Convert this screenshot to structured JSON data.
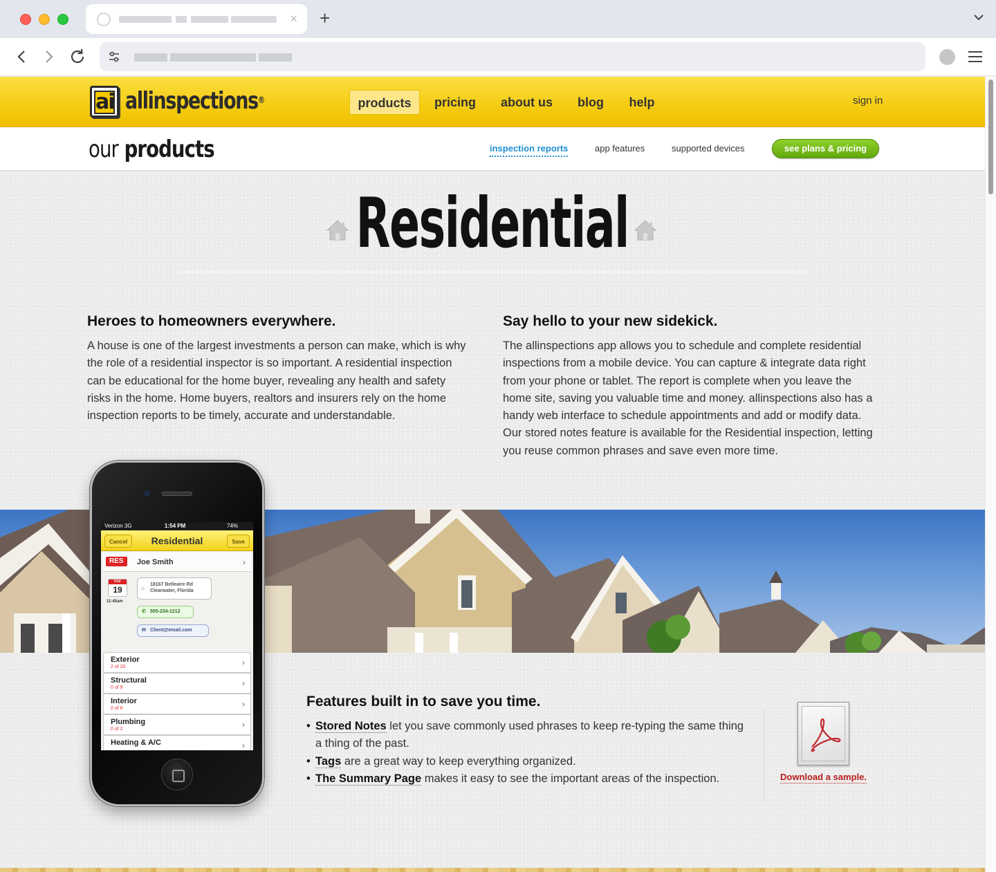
{
  "browser": {
    "tab_close_glyph": "×",
    "new_tab_glyph": "+"
  },
  "header": {
    "logo_mark": "ai",
    "logo_text": "allinspections",
    "logo_reg": "®",
    "nav": [
      {
        "label": "products",
        "active": true
      },
      {
        "label": "pricing",
        "active": false
      },
      {
        "label": "about us",
        "active": false
      },
      {
        "label": "blog",
        "active": false
      },
      {
        "label": "help",
        "active": false
      }
    ],
    "signin": "sign in"
  },
  "subnav": {
    "title_prefix": "our",
    "title_main": "products",
    "tabs": [
      {
        "label": "inspection reports",
        "active": true
      },
      {
        "label": "app features",
        "active": false
      },
      {
        "label": "supported devices",
        "active": false
      }
    ],
    "cta": "see plans & pricing"
  },
  "hero": {
    "title": "Residential"
  },
  "left": {
    "heading": "Heroes to homeowners everywhere.",
    "body": "A house is one of the largest investments a person can make, which is why the role of a residential inspector is so important. A residential inspection can be educational for the home buyer, revealing any health and safety risks in the home. Home buyers, realtors and insurers rely on the home inspection reports to be timely, accurate and understandable."
  },
  "right": {
    "heading": "Say hello to your new sidekick.",
    "body": "The allinspections app allows you to schedule and complete residential inspections from a mobile device. You can capture & integrate data right from your phone or tablet. The report is complete when you leave the home site, saving you valuable time and money. allinspections also has a handy web interface to schedule appointments and add or modify data. Our stored notes feature is available for the Residential inspection, letting you reuse common phrases and save even more time."
  },
  "phone": {
    "carrier": "Verizon 3G",
    "time": "1:54 PM",
    "battery": "74%",
    "cancel": "Cancel",
    "title": "Residential",
    "save": "Save",
    "badge": "RES",
    "client": "Joe Smith",
    "cal_month": "Mar",
    "cal_day": "19",
    "appt_time": "11:45am",
    "address_line1": "18167 Belleaire Rd",
    "address_line2": "Clearwater, Florida",
    "phone_number": "555-234-1212",
    "email": "Client@email.com",
    "sections": [
      {
        "name": "Exterior",
        "progress": "2 of 20"
      },
      {
        "name": "Structural",
        "progress": "0 of 9"
      },
      {
        "name": "Interior",
        "progress": "0 of 6"
      },
      {
        "name": "Plumbing",
        "progress": "0 of 2"
      },
      {
        "name": "Heating & A/C",
        "progress": ""
      }
    ]
  },
  "features": {
    "heading": "Features built in to save you time.",
    "items": [
      {
        "term": "Stored Notes",
        "text": " let you save commonly used phrases to keep re-typing the same thing a thing of the past."
      },
      {
        "term": "Tags",
        "text": " are a great way to keep everything organized."
      },
      {
        "term": "The Summary Page",
        "text": " makes it easy to see the important areas of the inspection."
      }
    ],
    "download": "Download a sample."
  },
  "colors": {
    "brand_yellow": "#f5cc12",
    "cta_green": "#6fb81a",
    "link_blue": "#1f8fd6",
    "download_red": "#b51d1d"
  }
}
